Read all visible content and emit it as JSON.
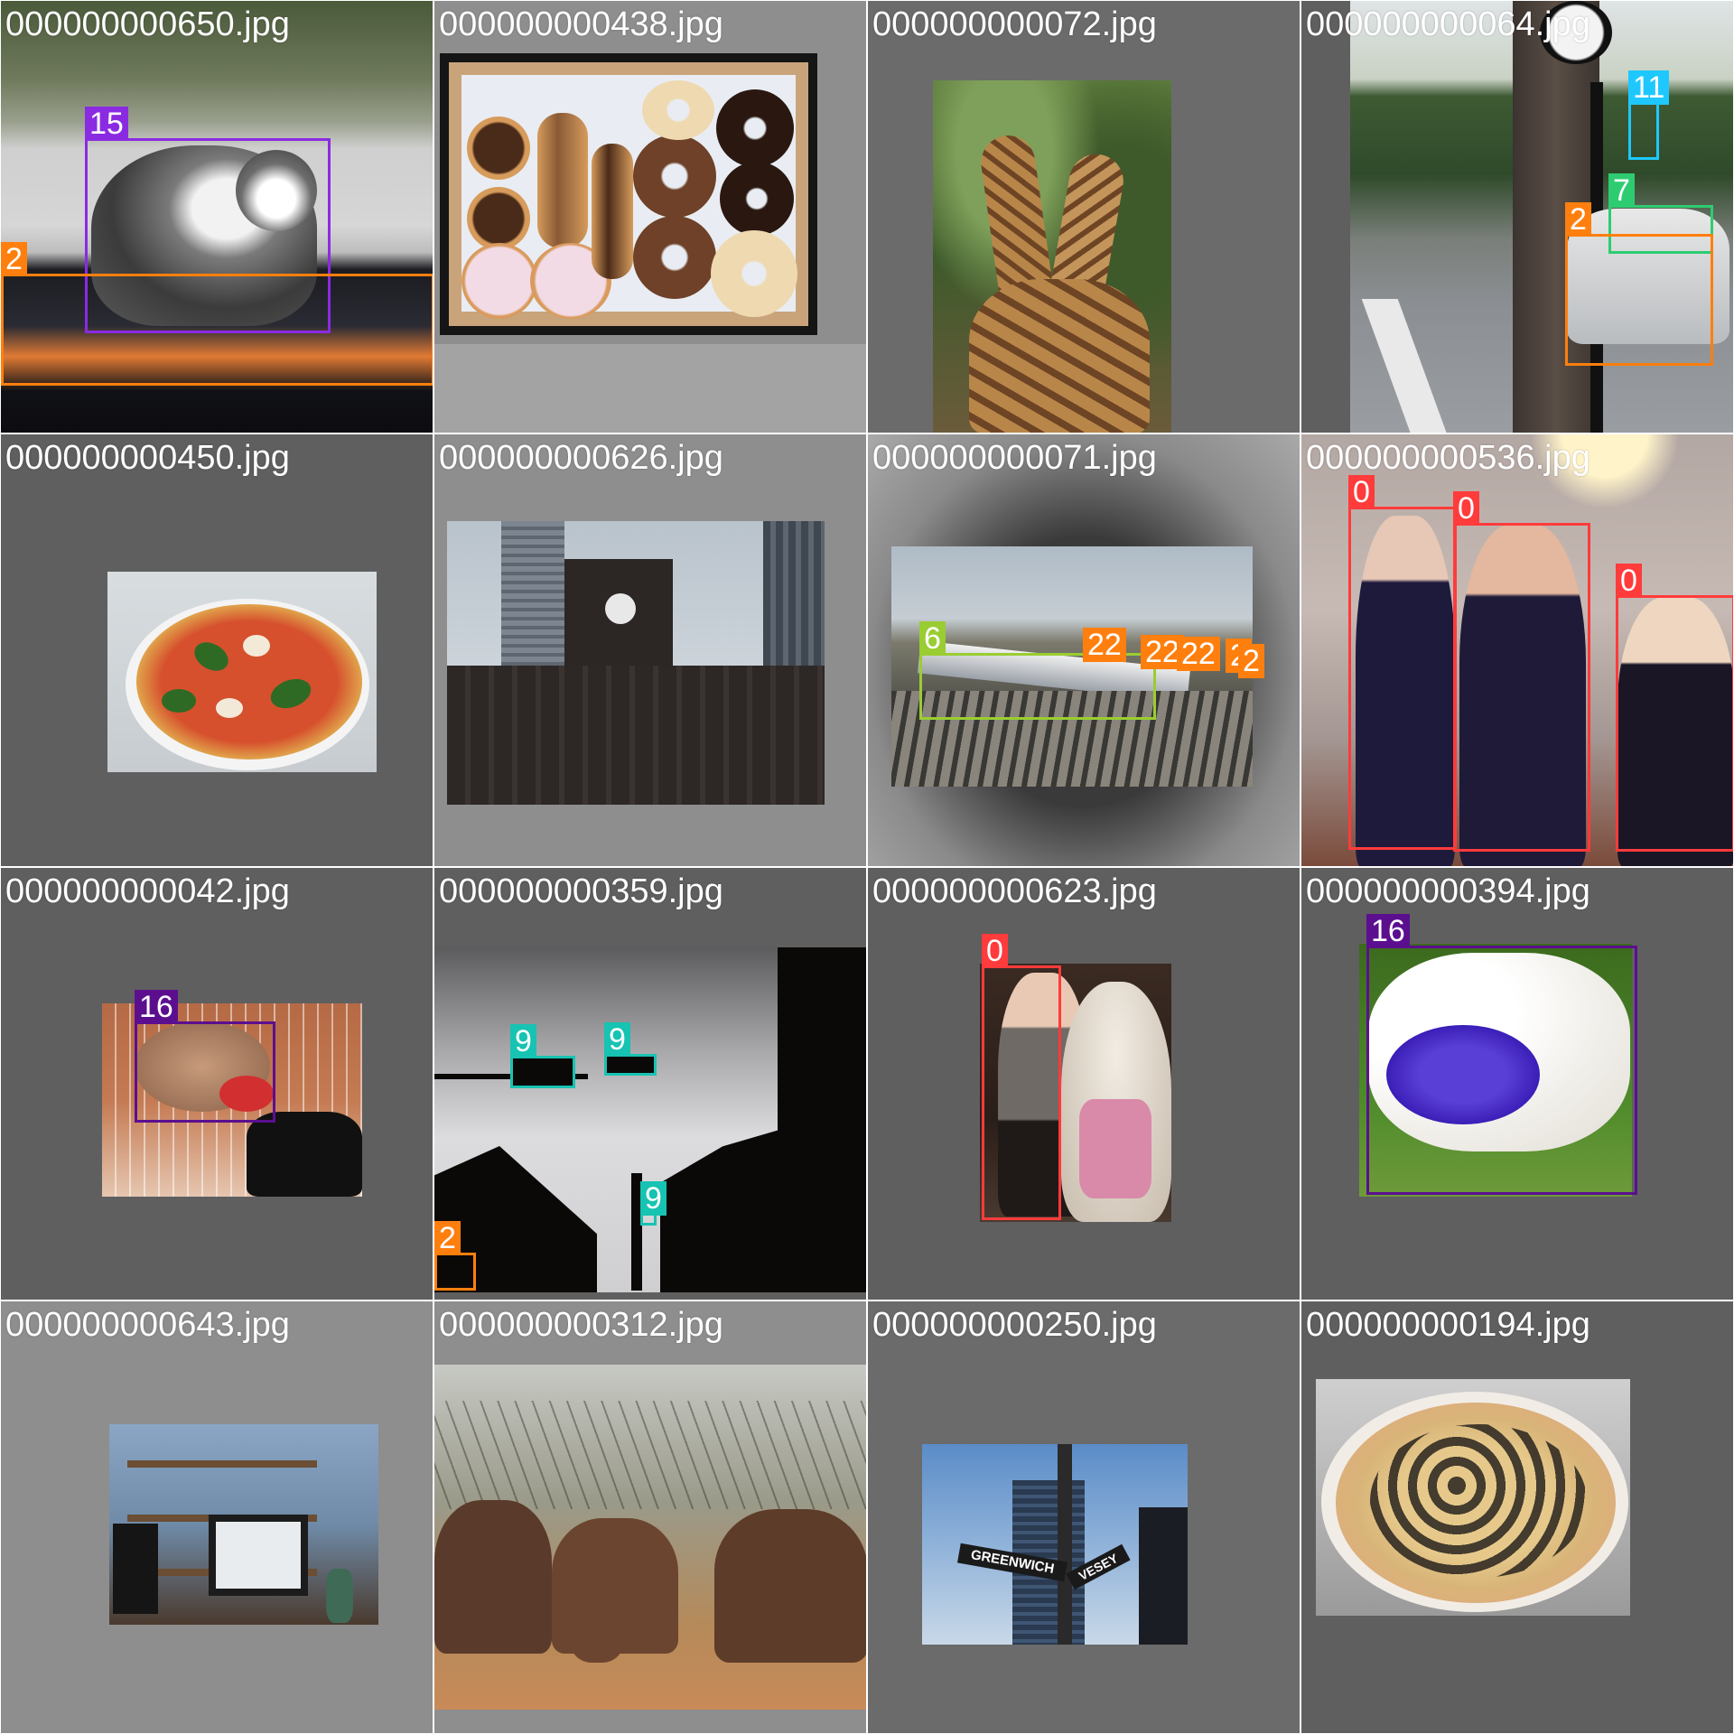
{
  "grid": {
    "tiles": [
      {
        "filename": "000000000650.jpg",
        "subject": "cat on car roof",
        "boxes": [
          {
            "label": "15",
            "color": "#8a2be2"
          },
          {
            "label": "2",
            "color": "#ff7f0e"
          }
        ]
      },
      {
        "filename": "000000000438.jpg",
        "subject": "box of donuts",
        "boxes": []
      },
      {
        "filename": "000000000072.jpg",
        "subject": "two giraffes",
        "boxes": []
      },
      {
        "filename": "000000000064.jpg",
        "subject": "street clock",
        "boxes": [
          {
            "label": "11",
            "color": "#1ec8ff"
          },
          {
            "label": "7",
            "color": "#2ecc71"
          },
          {
            "label": "2",
            "color": "#ff7f0e"
          }
        ]
      },
      {
        "filename": "000000000450.jpg",
        "subject": "pizza margherita",
        "boxes": []
      },
      {
        "filename": "000000000626.jpg",
        "subject": "clock tower building",
        "boxes": []
      },
      {
        "filename": "000000000071.jpg",
        "subject": "train yard",
        "boxes": [
          {
            "label": "6",
            "color": "#9acd32"
          },
          {
            "label": "22",
            "color": "#ff7f0e"
          },
          {
            "label": "22",
            "color": "#ff7f0e"
          },
          {
            "label": "22",
            "color": "#ff7f0e"
          },
          {
            "label": "2",
            "color": "#ff7f0e"
          },
          {
            "label": "2",
            "color": "#ff7f0e"
          }
        ]
      },
      {
        "filename": "000000000536.jpg",
        "subject": "three women in dresses",
        "boxes": [
          {
            "label": "0",
            "color": "#ff3b3b"
          },
          {
            "label": "0",
            "color": "#ff3b3b"
          },
          {
            "label": "0",
            "color": "#ff3b3b"
          }
        ]
      },
      {
        "filename": "000000000042.jpg",
        "subject": "dog in basket",
        "boxes": [
          {
            "label": "16",
            "color": "#5b0f8f"
          }
        ]
      },
      {
        "filename": "000000000359.jpg",
        "subject": "traffic lights silhouette",
        "boxes": [
          {
            "label": "9",
            "color": "#17c3b2"
          },
          {
            "label": "9",
            "color": "#17c3b2"
          },
          {
            "label": "9",
            "color": "#17c3b2"
          },
          {
            "label": "2",
            "color": "#ff7f0e"
          }
        ]
      },
      {
        "filename": "000000000623.jpg",
        "subject": "girl with teddy bear",
        "boxes": [
          {
            "label": "0",
            "color": "#ff3b3b"
          }
        ]
      },
      {
        "filename": "000000000394.jpg",
        "subject": "dog with frisbee",
        "boxes": [
          {
            "label": "16",
            "color": "#5b0f8f"
          }
        ]
      },
      {
        "filename": "000000000643.jpg",
        "subject": "computer desk",
        "boxes": []
      },
      {
        "filename": "000000000312.jpg",
        "subject": "elephants",
        "boxes": []
      },
      {
        "filename": "000000000250.jpg",
        "subject": "street sign greenwich vesey",
        "boxes": []
      },
      {
        "filename": "000000000194.jpg",
        "subject": "pizza",
        "boxes": []
      }
    ],
    "sign_text": {
      "greenwich": "GREENWICH",
      "vesey": "VESEY"
    }
  },
  "colors": {
    "tile_bg_dark": "#5f5f5f",
    "tile_bg_light": "#8c8c8c",
    "label_text": "#ffffff"
  }
}
